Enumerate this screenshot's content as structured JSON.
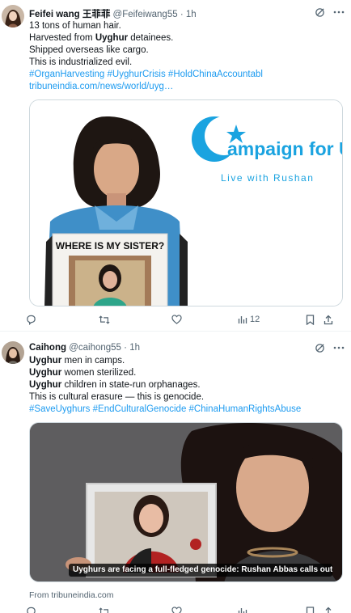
{
  "tweets": [
    {
      "author": "Feifei wang 王菲菲",
      "handle": "@Feifeiwang55",
      "separator": "·",
      "time": "1h",
      "lines": [
        "13 tons of human hair.",
        "Harvested from ",
        "Shipped overseas like cargo.",
        "This is industrialized evil."
      ],
      "bold_word": "Uyghur",
      "line2_suffix": " detainees.",
      "hashtags": "#OrganHarvesting #UyghurCrisis #HoldChinaAccountabl",
      "url": "tribuneindia.com/news/world/uyg…",
      "media": {
        "sign_text": "WHERE IS MY SISTER?",
        "banner_title": "ampaign for Uygh",
        "banner_subtitle": "Live with Rushan"
      },
      "stats": {
        "views": "12"
      }
    },
    {
      "author": "Caihong",
      "handle": "@caihong55",
      "separator": "·",
      "time": "1h",
      "bold_word": "Uyghur",
      "line1_suffix": " men in camps.",
      "line2_suffix": " women sterilized.",
      "line3_suffix": " children in state-run orphanages.",
      "line4": "This is cultural erasure — this is genocide.",
      "hashtags": "#SaveUyghurs #EndCulturalGenocide #ChinaHumanRightsAbuse",
      "media": {
        "caption": "Uyghurs are facing a full-fledged genocide: Rushan Abbas calls out Chinas cri..."
      },
      "source": "From tribuneindia.com"
    }
  ],
  "colors": {
    "link": "#1d9bf0",
    "muted": "#536471",
    "text": "#0f1419",
    "banner_blue": "#1aa3e0"
  },
  "icons": [
    "grok-icon",
    "more-icon",
    "reply-icon",
    "retweet-icon",
    "like-icon",
    "views-icon",
    "bookmark-icon",
    "share-icon"
  ]
}
